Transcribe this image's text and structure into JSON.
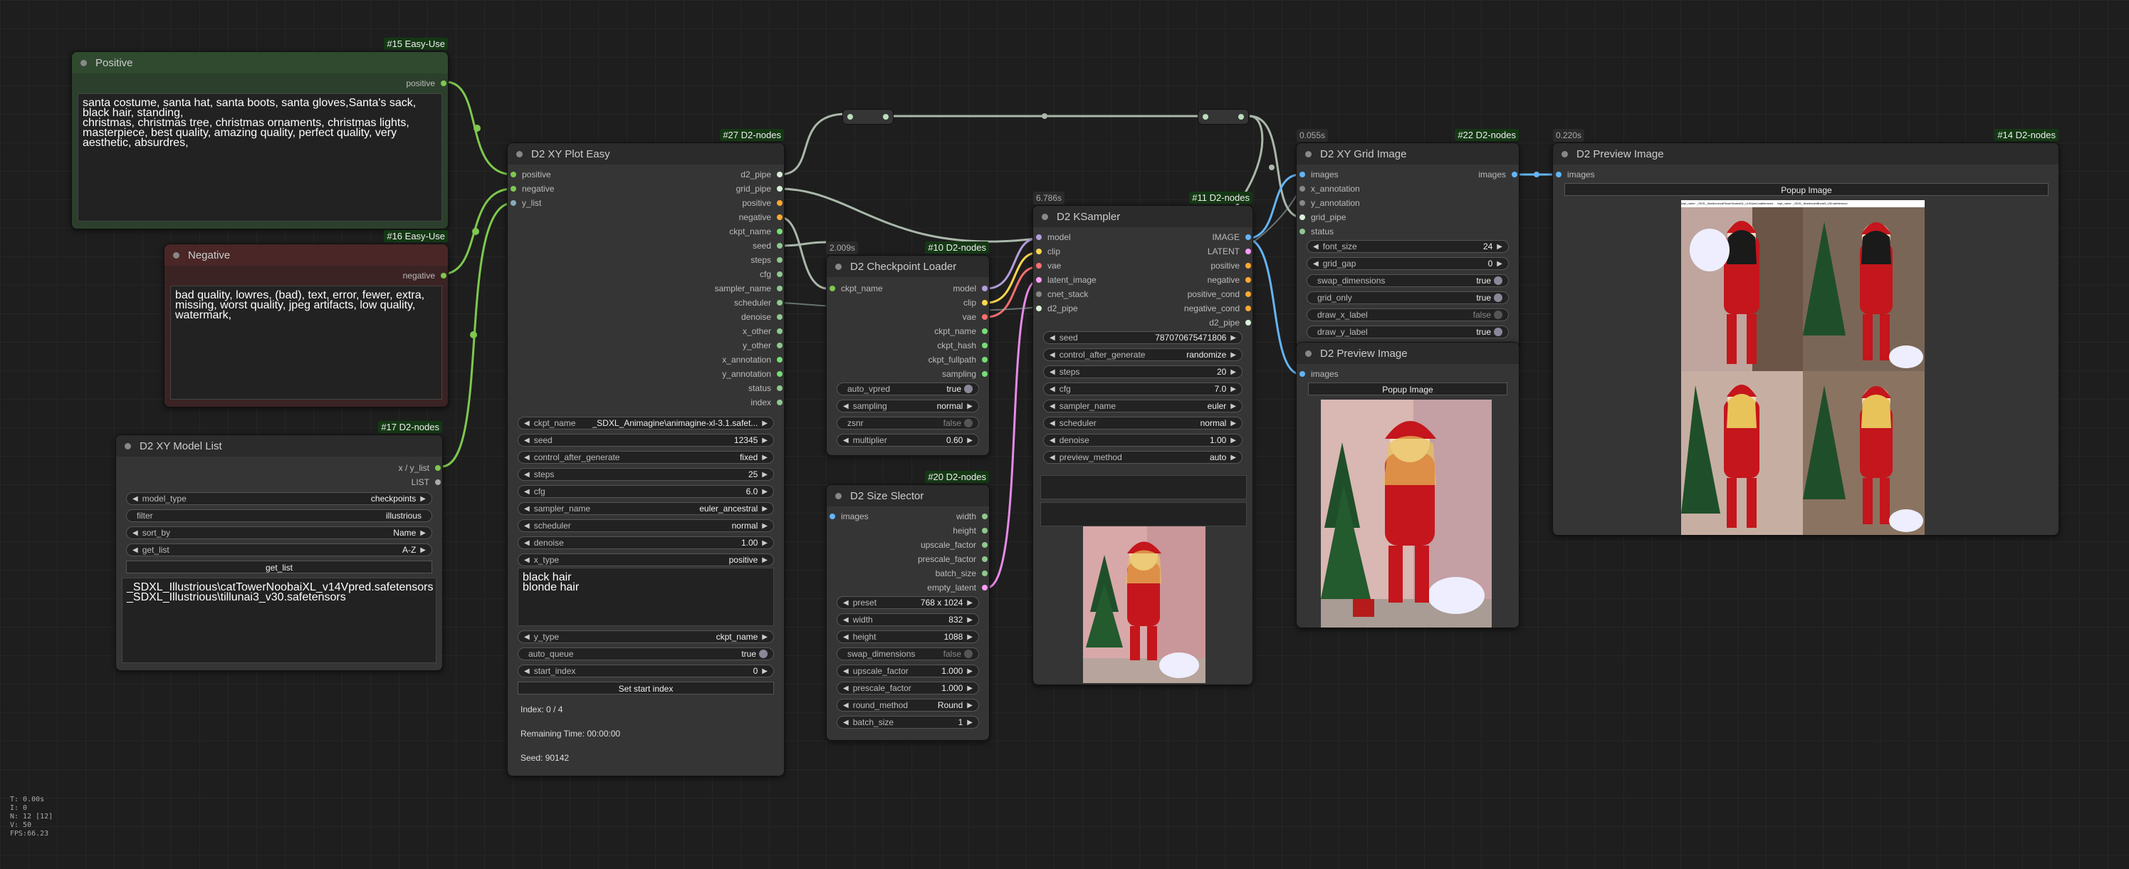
{
  "colors": {
    "model": "#b39ddb",
    "clip": "#ffd54f",
    "vae": "#ff6e6e",
    "latent": "#ff9cf9",
    "pipe": "#d8f0d8",
    "image": "#64b5f6",
    "cond": "#ffa931",
    "string": "#77dd77",
    "int": "#8fc88f"
  },
  "positive": {
    "badge": "#15 Easy-Use",
    "title": "Positive",
    "out": "positive",
    "text": "santa costume, santa hat, santa boots, santa gloves,Santa's sack, black hair, standing,\nchristmas, christmas tree, christmas ornaments, christmas lights,\nmasterpiece, best quality, amazing quality, perfect quality, very aesthetic, absurdres,"
  },
  "negative": {
    "badge": "#16 Easy-Use",
    "title": "Negative",
    "out": "negative",
    "text": "bad quality, lowres, (bad), text, error, fewer, extra, missing, worst quality, jpeg artifacts, low quality, watermark,"
  },
  "modellist": {
    "badge": "#17 D2-nodes",
    "title": "D2 XY Model List",
    "outs": [
      "x / y_list",
      "LIST"
    ],
    "model_type": {
      "label": "model_type",
      "value": "checkpoints"
    },
    "filter": {
      "label": "filter",
      "value": "illustrious"
    },
    "sort_by": {
      "label": "sort_by",
      "value": "Name"
    },
    "get_list": {
      "label": "get_list",
      "value": "A-Z"
    },
    "button": "get_list",
    "text": "_SDXL_Illustrious\\catTowerNoobaiXL_v14Vpred.safetensors\n_SDXL_Illustrious\\tillunai3_v30.safetensors"
  },
  "xyplot": {
    "badge": "#27 D2-nodes",
    "title": "D2 XY Plot Easy",
    "ins": [
      "positive",
      "negative",
      "y_list"
    ],
    "outs": [
      "d2_pipe",
      "grid_pipe",
      "positive",
      "negative",
      "ckpt_name",
      "seed",
      "steps",
      "cfg",
      "sampler_name",
      "scheduler",
      "denoise",
      "x_other",
      "y_other",
      "x_annotation",
      "y_annotation",
      "status",
      "index"
    ],
    "widgets": [
      {
        "label": "ckpt_name",
        "value": "_SDXL_Animagine\\animagine-xl-3.1.safet..."
      },
      {
        "label": "seed",
        "value": "12345"
      },
      {
        "label": "control_after_generate",
        "value": "fixed"
      },
      {
        "label": "steps",
        "value": "25"
      },
      {
        "label": "cfg",
        "value": "6.0"
      },
      {
        "label": "sampler_name",
        "value": "euler_ancestral"
      },
      {
        "label": "scheduler",
        "value": "normal"
      },
      {
        "label": "denoise",
        "value": "1.00"
      },
      {
        "label": "x_type",
        "value": "positive"
      }
    ],
    "text": "black hair\nblonde hair",
    "widgets2": [
      {
        "label": "y_type",
        "value": "ckpt_name"
      }
    ],
    "auto_queue": {
      "label": "auto_queue",
      "value": "true"
    },
    "start_index": {
      "label": "start_index",
      "value": "0"
    },
    "button": "Set start index",
    "index": "Index: 0 / 4",
    "remaining": "Remaining Time: 00:00:00",
    "seed_info": "Seed: 90142"
  },
  "ckpt": {
    "badge": "#10 D2-nodes",
    "time": "2.009s",
    "title": "D2 Checkpoint Loader",
    "ins": [
      "ckpt_name"
    ],
    "outs": [
      "model",
      "clip",
      "vae",
      "ckpt_name",
      "ckpt_hash",
      "ckpt_fullpath",
      "sampling"
    ],
    "auto_vpred": {
      "label": "auto_vpred",
      "value": "true"
    },
    "sampling": {
      "label": "sampling",
      "value": "normal"
    },
    "zsnr": {
      "label": "zsnr",
      "value": "false"
    },
    "multiplier": {
      "label": "multiplier",
      "value": "0.60"
    }
  },
  "size": {
    "badge": "#20 D2-nodes",
    "title": "D2 Size Slector",
    "ins": [
      "images"
    ],
    "outs": [
      "width",
      "height",
      "upscale_factor",
      "prescale_factor",
      "batch_size",
      "empty_latent"
    ],
    "widgets": [
      {
        "label": "preset",
        "value": "768 x 1024"
      },
      {
        "label": "width",
        "value": "832"
      },
      {
        "label": "height",
        "value": "1088"
      }
    ],
    "swap": {
      "label": "swap_dimensions",
      "value": "false"
    },
    "widgets2": [
      {
        "label": "upscale_factor",
        "value": "1.000"
      },
      {
        "label": "prescale_factor",
        "value": "1.000"
      },
      {
        "label": "round_method",
        "value": "Round"
      },
      {
        "label": "batch_size",
        "value": "1"
      }
    ]
  },
  "ksampler": {
    "badge": "#11 D2-nodes",
    "time": "6.786s",
    "title": "D2 KSampler",
    "ins": [
      "model",
      "clip",
      "vae",
      "latent_image",
      "cnet_stack",
      "d2_pipe"
    ],
    "outs": [
      "IMAGE",
      "LATENT",
      "positive",
      "negative",
      "positive_cond",
      "negative_cond",
      "d2_pipe"
    ],
    "widgets": [
      {
        "label": "seed",
        "value": "787070675471806"
      },
      {
        "label": "control_after_generate",
        "value": "randomize"
      },
      {
        "label": "steps",
        "value": "20"
      },
      {
        "label": "cfg",
        "value": "7.0"
      },
      {
        "label": "sampler_name",
        "value": "euler"
      },
      {
        "label": "scheduler",
        "value": "normal"
      },
      {
        "label": "denoise",
        "value": "1.00"
      },
      {
        "label": "preview_method",
        "value": "auto"
      }
    ]
  },
  "grid": {
    "badge": "#22 D2-nodes",
    "time": "0.055s",
    "title": "D2 XY Grid Image",
    "ins": [
      "images",
      "x_annotation",
      "y_annotation",
      "grid_pipe",
      "status"
    ],
    "outs": [
      "images"
    ],
    "widgets": [
      {
        "label": "font_size",
        "value": "24"
      },
      {
        "label": "grid_gap",
        "value": "0"
      }
    ],
    "toggles": [
      {
        "label": "swap_dimensions",
        "value": "true",
        "on": true
      },
      {
        "label": "grid_only",
        "value": "true",
        "on": true
      },
      {
        "label": "draw_x_label",
        "value": "false",
        "on": false
      },
      {
        "label": "draw_y_label",
        "value": "true",
        "on": true
      }
    ]
  },
  "preview1": {
    "title": "D2 Preview Image",
    "in": "images",
    "button": "Popup Image"
  },
  "preview2": {
    "badge": "#14 D2-nodes",
    "time": "0.220s",
    "title": "D2 Preview Image",
    "in": "images",
    "button": "Popup Image",
    "header_text": "ckpt_name: _SDXL_Illustrious\\catTowerNoobaiXL_v14Vpred.safetensors     ckpt_name: _SDXL_Illustrious\\tillunai3_v30.safetensors"
  },
  "stats": [
    "T: 0.00s",
    "I: 0",
    "N: 12 [12]",
    "V: 50",
    "FPS:66.23"
  ]
}
